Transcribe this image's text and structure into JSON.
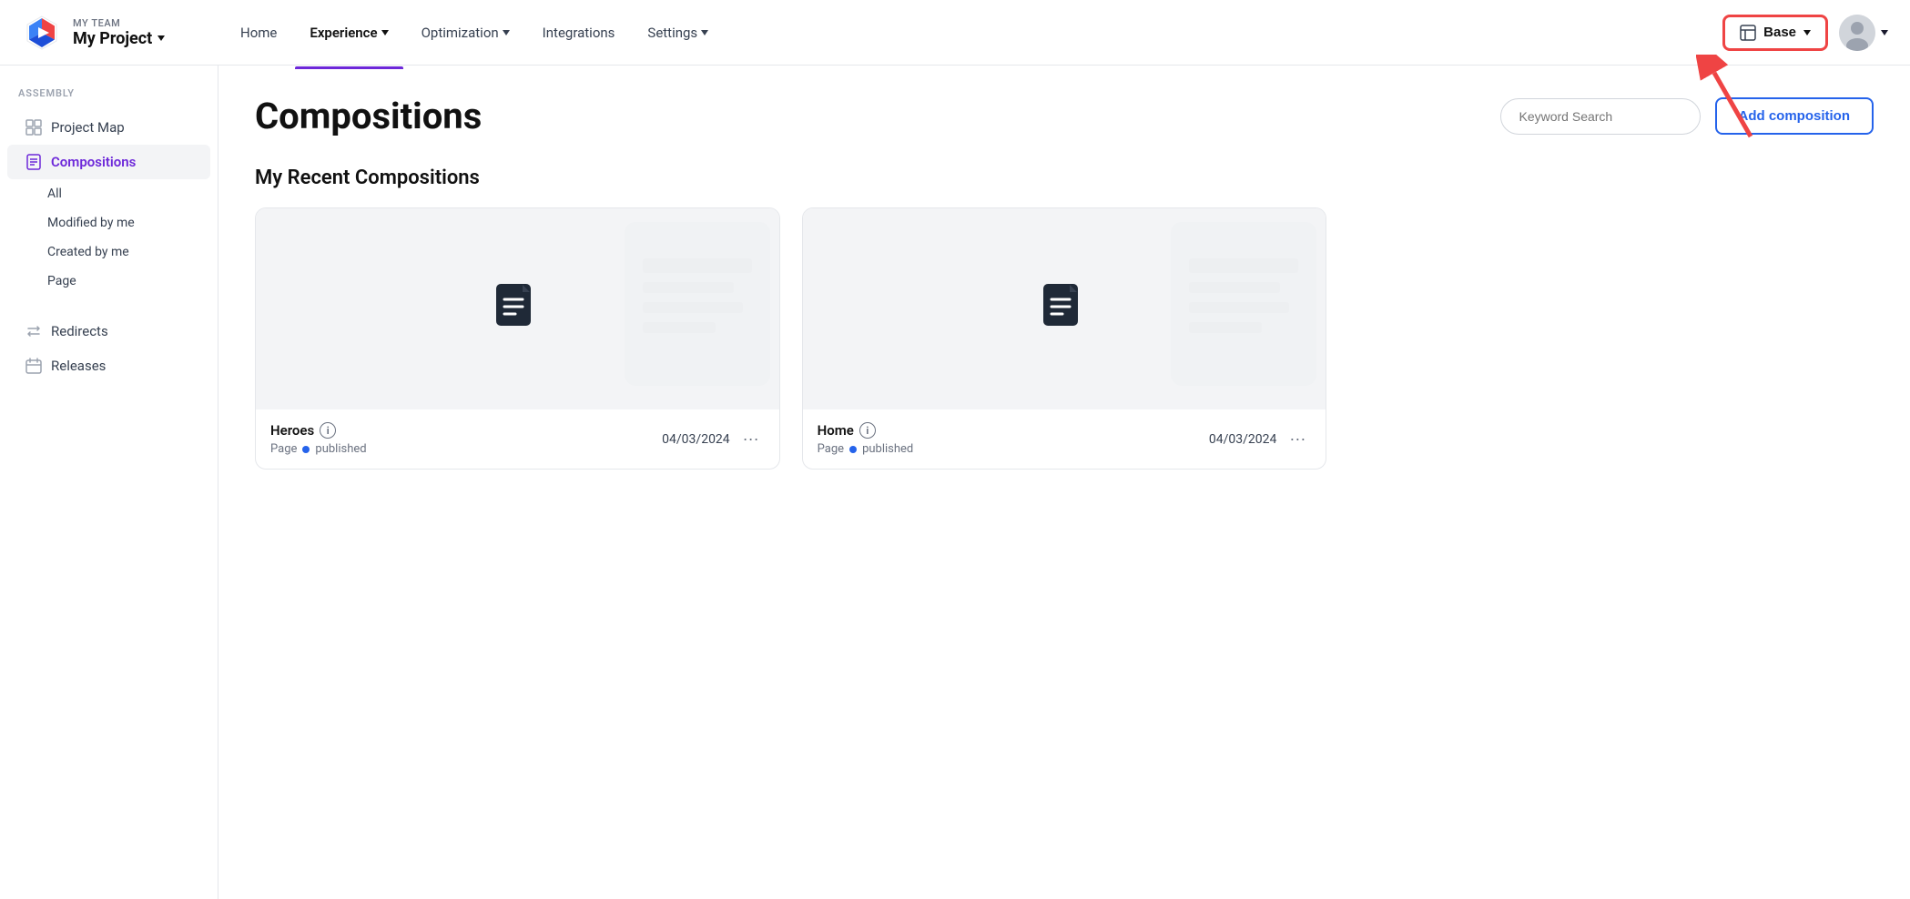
{
  "header": {
    "team_label": "MY TEAM",
    "project_name": "My Project",
    "nav_items": [
      {
        "label": "Home",
        "active": false
      },
      {
        "label": "Experience",
        "dropdown": true,
        "active": true
      },
      {
        "label": "Optimization",
        "dropdown": true,
        "active": false
      },
      {
        "label": "Integrations",
        "active": false
      },
      {
        "label": "Settings",
        "dropdown": true,
        "active": false
      }
    ],
    "env_button_label": "Base",
    "env_icon": "□"
  },
  "sidebar": {
    "section_label": "ASSEMBLY",
    "items": [
      {
        "label": "Project Map",
        "icon": "grid",
        "active": false
      },
      {
        "label": "Compositions",
        "icon": "doc",
        "active": true
      }
    ],
    "sub_items": [
      {
        "label": "All"
      },
      {
        "label": "Modified by me"
      },
      {
        "label": "Created by me"
      },
      {
        "label": "Page"
      }
    ],
    "bottom_items": [
      {
        "label": "Redirects",
        "icon": "arrows"
      },
      {
        "label": "Releases",
        "icon": "calendar"
      }
    ]
  },
  "main": {
    "page_title": "Compositions",
    "search_placeholder": "Keyword Search",
    "add_button_label": "Add composition",
    "section_title": "My Recent Compositions",
    "cards": [
      {
        "name": "Heroes",
        "type": "Page",
        "status": "published",
        "date": "04/03/2024"
      },
      {
        "name": "Home",
        "type": "Page",
        "status": "published",
        "date": "04/03/2024"
      }
    ]
  }
}
